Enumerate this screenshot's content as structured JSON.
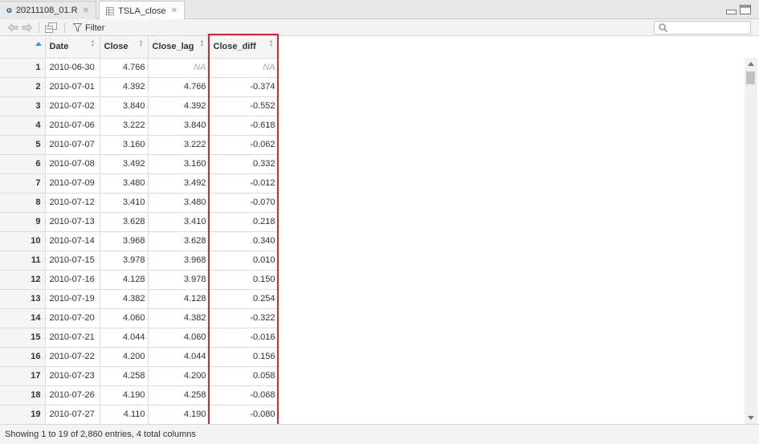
{
  "tabs": [
    {
      "label": "20211108_01.R",
      "icon": "r-script-icon",
      "active": false
    },
    {
      "label": "TSLA_close",
      "icon": "table-icon",
      "active": true
    }
  ],
  "toolbar": {
    "filter_label": "Filter",
    "search_placeholder": ""
  },
  "table": {
    "columns": [
      "Date",
      "Close",
      "Close_lag",
      "Close_diff"
    ],
    "rows": [
      {
        "n": "1",
        "date": "2010-06-30",
        "close": "4.766",
        "lag": "NA",
        "diff": "NA"
      },
      {
        "n": "2",
        "date": "2010-07-01",
        "close": "4.392",
        "lag": "4.766",
        "diff": "-0.374"
      },
      {
        "n": "3",
        "date": "2010-07-02",
        "close": "3.840",
        "lag": "4.392",
        "diff": "-0.552"
      },
      {
        "n": "4",
        "date": "2010-07-06",
        "close": "3.222",
        "lag": "3.840",
        "diff": "-0.618"
      },
      {
        "n": "5",
        "date": "2010-07-07",
        "close": "3.160",
        "lag": "3.222",
        "diff": "-0.062"
      },
      {
        "n": "6",
        "date": "2010-07-08",
        "close": "3.492",
        "lag": "3.160",
        "diff": "0.332"
      },
      {
        "n": "7",
        "date": "2010-07-09",
        "close": "3.480",
        "lag": "3.492",
        "diff": "-0.012"
      },
      {
        "n": "8",
        "date": "2010-07-12",
        "close": "3.410",
        "lag": "3.480",
        "diff": "-0.070"
      },
      {
        "n": "9",
        "date": "2010-07-13",
        "close": "3.628",
        "lag": "3.410",
        "diff": "0.218"
      },
      {
        "n": "10",
        "date": "2010-07-14",
        "close": "3.968",
        "lag": "3.628",
        "diff": "0.340"
      },
      {
        "n": "11",
        "date": "2010-07-15",
        "close": "3.978",
        "lag": "3.968",
        "diff": "0.010"
      },
      {
        "n": "12",
        "date": "2010-07-16",
        "close": "4.128",
        "lag": "3.978",
        "diff": "0.150"
      },
      {
        "n": "13",
        "date": "2010-07-19",
        "close": "4.382",
        "lag": "4.128",
        "diff": "0.254"
      },
      {
        "n": "14",
        "date": "2010-07-20",
        "close": "4.060",
        "lag": "4.382",
        "diff": "-0.322"
      },
      {
        "n": "15",
        "date": "2010-07-21",
        "close": "4.044",
        "lag": "4.060",
        "diff": "-0.016"
      },
      {
        "n": "16",
        "date": "2010-07-22",
        "close": "4.200",
        "lag": "4.044",
        "diff": "0.156"
      },
      {
        "n": "17",
        "date": "2010-07-23",
        "close": "4.258",
        "lag": "4.200",
        "diff": "0.058"
      },
      {
        "n": "18",
        "date": "2010-07-26",
        "close": "4.190",
        "lag": "4.258",
        "diff": "-0.068"
      },
      {
        "n": "19",
        "date": "2010-07-27",
        "close": "4.110",
        "lag": "4.190",
        "diff": "-0.080"
      }
    ]
  },
  "status": {
    "text": "Showing 1 to 19 of 2,860 entries, 4 total columns"
  },
  "colors": {
    "highlight": "#d9252d",
    "sort_accent": "#3a8fd6"
  }
}
